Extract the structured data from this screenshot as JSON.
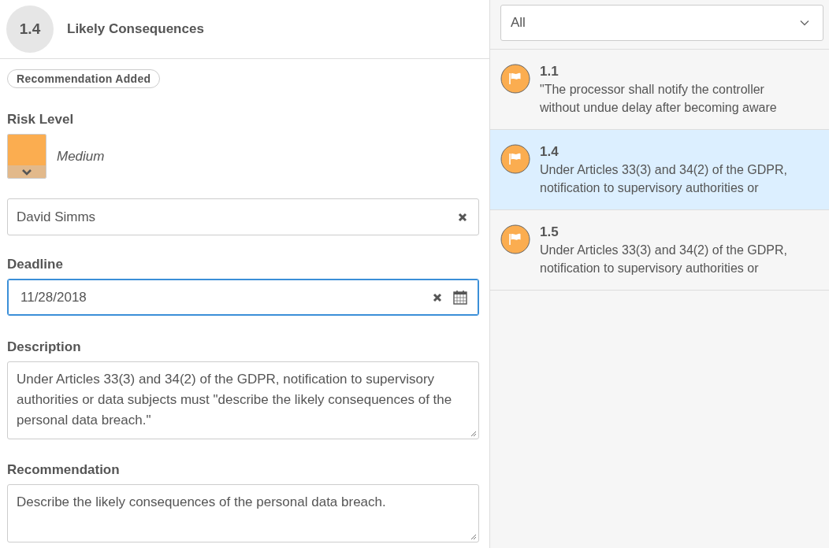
{
  "detail": {
    "number": "1.4",
    "title": "Likely Consequences",
    "badge": "Recommendation Added",
    "risk_level": {
      "label": "Risk Level",
      "value": "Medium",
      "kind": "medium"
    },
    "assignee": {
      "value": "David Simms"
    },
    "deadline": {
      "label": "Deadline",
      "value": "11/28/2018",
      "focused": true
    },
    "description": {
      "label": "Description",
      "value": "Under Articles 33(3) and 34(2) of the GDPR, notification to supervisory authorities or data subjects must \"describe the likely consequences of the personal data breach.\""
    },
    "recommendation": {
      "label": "Recommendation",
      "value": "Describe the likely consequences of the personal data breach."
    }
  },
  "filter": {
    "value": "All"
  },
  "findings": [
    {
      "number": "1.1",
      "lines": [
        "\"The processor shall notify the controller",
        "without undue delay after becoming aware"
      ],
      "selected": false
    },
    {
      "number": "1.4",
      "lines": [
        "Under Articles 33(3) and 34(2) of the GDPR,",
        "notification to supervisory authorities or"
      ],
      "selected": true
    },
    {
      "number": "1.5",
      "lines": [
        "Under Articles 33(3) and 34(2) of the GDPR,",
        "notification to supervisory authorities or"
      ],
      "selected": false
    }
  ]
}
